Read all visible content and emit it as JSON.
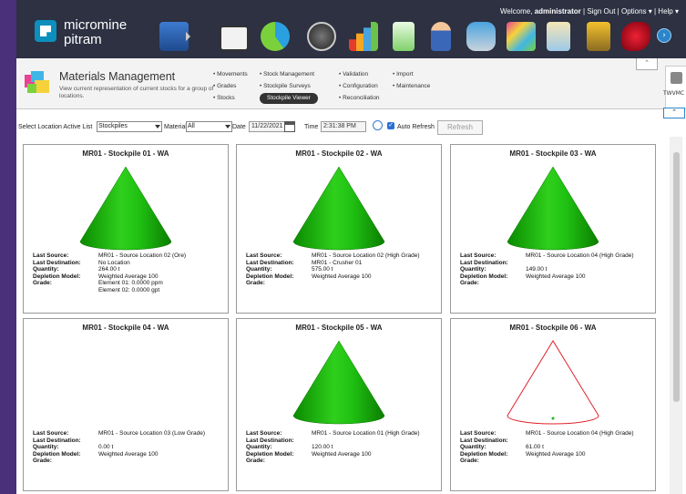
{
  "header": {
    "logo_line1": "micromine",
    "logo_line2": "pitram",
    "welcome_prefix": "Welcome,",
    "user": "administrator",
    "links": "| Sign Out | Options ▾ | Help ▾"
  },
  "app_icons": [
    "pitram-app-icon",
    "chart-app-icon",
    "pie-chart-icon",
    "gauge-icon",
    "bar-chart-icon",
    "document-icon",
    "user-icon",
    "database-icon",
    "materials-icon",
    "clipboard-icon",
    "toolkit-icon",
    "explosives-icon"
  ],
  "module": {
    "title": "Materials Management",
    "description": "View current representation of current stocks for a group of locations.",
    "nav_col1": [
      "• Movements",
      "• Grades",
      "• Stocks"
    ],
    "nav_col2": [
      "• Stock Management",
      "• Stockpile Surveys",
      "Stockpile Viewer"
    ],
    "nav_col3": [
      "• Validation",
      "• Configuration",
      "• Reconciliation"
    ],
    "nav_col4": [
      "• Import",
      "• Maintenance"
    ],
    "tool_label": "TWVMC"
  },
  "filters": {
    "location_list_label": "Select Location Active List",
    "location_list_value": "Stockpiles",
    "material_label": "Material",
    "material_value": "All",
    "date_label": "Date",
    "date_value": "11/22/2021",
    "time_label": "Time",
    "time_value": "2:31:38 PM",
    "auto_refresh_label": "Auto Refresh",
    "refresh_label": "Refresh"
  },
  "labels": {
    "last_source": "Last Source:",
    "last_destination": "Last Destination:",
    "quantity": "Quantity:",
    "depletion_model": "Depletion Model:",
    "grade": "Grade:"
  },
  "stockpiles": [
    {
      "title": "MR01 - Stockpile 01 - WA",
      "fill": "full",
      "last_source": "MR01 - Source Location 02 (Ore)",
      "last_destination": "No Location",
      "quantity": "264.00 t",
      "depletion_model": "Weighted Average 100",
      "grade": [
        "Element 01: 0.0000 ppm",
        "Element 02: 0.0000 gpt"
      ]
    },
    {
      "title": "MR01 - Stockpile 02 - WA",
      "fill": "full",
      "last_source": "MR01 - Source Location 02 (High Grade)",
      "last_destination": "MR01 - Crusher 01",
      "quantity": "575.00 t",
      "depletion_model": "Weighted Average 100",
      "grade": []
    },
    {
      "title": "MR01 - Stockpile 03 - WA",
      "fill": "full",
      "last_source": "MR01 - Source Location 04 (High Grade)",
      "last_destination": "",
      "quantity": "149.00 t",
      "depletion_model": "Weighted Average 100",
      "grade": []
    },
    {
      "title": "MR01 - Stockpile 04 - WA",
      "fill": "empty",
      "last_source": "MR01 - Source Location 03 (Low Grade)",
      "last_destination": "",
      "quantity": "0.00 t",
      "depletion_model": "Weighted Average 100",
      "grade": []
    },
    {
      "title": "MR01 - Stockpile 05 - WA",
      "fill": "full",
      "last_source": "MR01 - Source Location 01 (High Grade)",
      "last_destination": "",
      "quantity": "120.00 t",
      "depletion_model": "Weighted Average 100",
      "grade": []
    },
    {
      "title": "MR01 - Stockpile 06 - WA",
      "fill": "outline",
      "last_source": "MR01 - Source Location 04 (High Grade)",
      "last_destination": "",
      "quantity": "61.00 t",
      "depletion_model": "Weighted Average 100",
      "grade": []
    }
  ]
}
